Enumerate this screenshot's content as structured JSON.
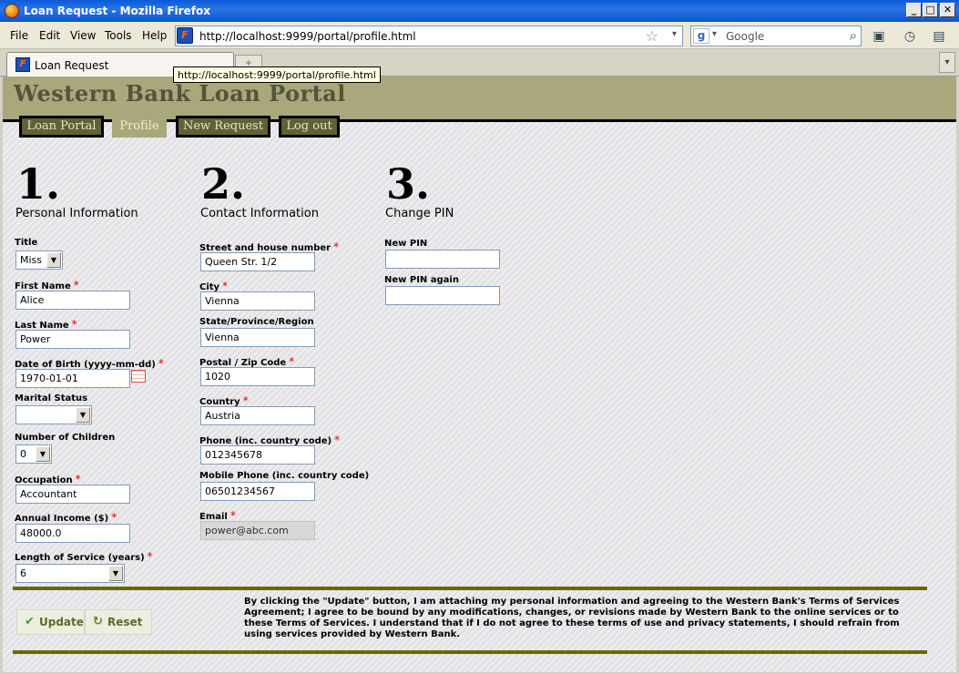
{
  "window": {
    "title": "Loan Request - Mozilla Firefox",
    "controls": {
      "minimize": "_",
      "maximize": "□",
      "close": "✕"
    }
  },
  "menu": {
    "items": [
      "File",
      "Edit",
      "View",
      "Tools",
      "Help"
    ]
  },
  "browser": {
    "url": "http://localhost:9999/portal/profile.html",
    "search_placeholder": "Google",
    "tab_label": "Loan Request",
    "tooltip": "http://localhost:9999/portal/profile.html"
  },
  "site": {
    "title": "Western Bank Loan Portal",
    "nav": [
      "Loan Portal",
      "Profile",
      "New Request",
      "Log out"
    ],
    "active_nav": "Profile"
  },
  "sections": {
    "personal": {
      "number": "1.",
      "title": "Personal Information"
    },
    "contact": {
      "number": "2.",
      "title": "Contact Information"
    },
    "pin": {
      "number": "3.",
      "title": "Change PIN"
    }
  },
  "personal": {
    "title_label": "Title",
    "title_value": "Miss",
    "first_name_label": "First Name",
    "first_name": "Alice",
    "last_name_label": "Last Name",
    "last_name": "Power",
    "dob_label": "Date of Birth (yyyy-mm-dd)",
    "dob": "1970-01-01",
    "marital_label": "Marital Status",
    "marital_value": "",
    "children_label": "Number of Children",
    "children_value": "0",
    "occupation_label": "Occupation",
    "occupation": "Accountant",
    "income_label": "Annual Income ($)",
    "income": "48000.0",
    "service_label": "Length of Service (years)",
    "service_value": "6"
  },
  "contact": {
    "street_label": "Street and house number",
    "street": "Queen Str. 1/2",
    "city_label": "City",
    "city": "Vienna",
    "state_label": "State/Province/Region",
    "state": "Vienna",
    "zip_label": "Postal / Zip Code",
    "zip": "1020",
    "country_label": "Country",
    "country": "Austria",
    "phone_label": "Phone (inc. country code)",
    "phone": "012345678",
    "mobile_label": "Mobile Phone (inc. country code)",
    "mobile": "06501234567",
    "email_label": "Email",
    "email": "power@abc.com"
  },
  "pin": {
    "new_pin_label": "New PIN",
    "new_pin": "",
    "new_pin_again_label": "New PIN again",
    "new_pin_again": ""
  },
  "required_marker": "*",
  "actions": {
    "update": "Update",
    "reset": "Reset"
  },
  "terms_text": "By clicking the \"Update\" button, I am attaching my personal information and agreeing to the Western Bank's Terms of Services Agreement; I agree to be bound by any modifications, changes, or revisions made by Western Bank to the online services or to these Terms of Services. I understand that if I do not agree to these terms of use and privacy statements, I should refrain from using services provided by Western Bank.",
  "colors": {
    "banner": "#a9a77c",
    "nav_tab": "#626034",
    "rule": "#6b6700",
    "required": "#dd0000"
  }
}
